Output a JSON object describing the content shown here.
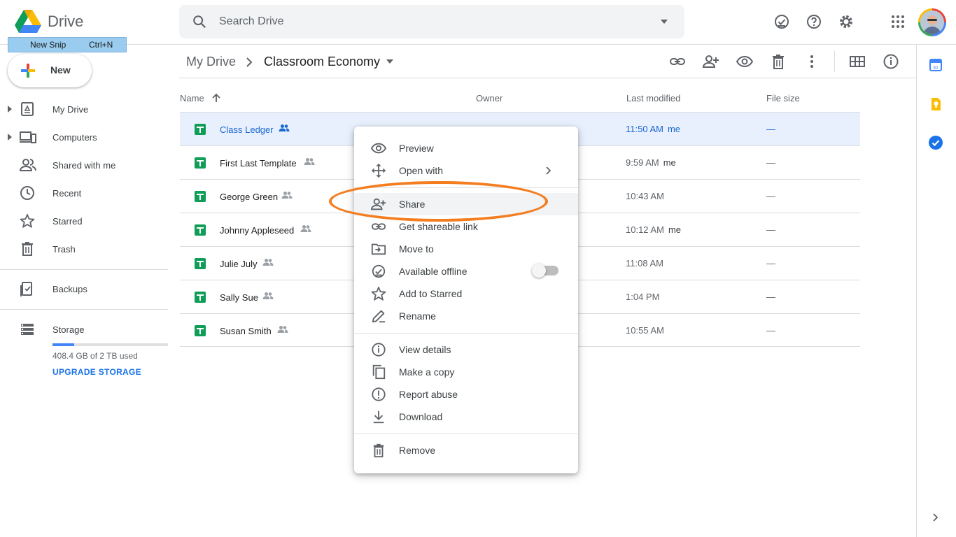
{
  "app": {
    "name": "Drive"
  },
  "snip_overlay": {
    "label": "New Snip",
    "shortcut": "Ctrl+N"
  },
  "search": {
    "placeholder": "Search Drive"
  },
  "new_button": {
    "label": "New"
  },
  "sidebar": {
    "items": [
      {
        "label": "My Drive",
        "icon": "my-drive-icon"
      },
      {
        "label": "Computers",
        "icon": "computers-icon"
      },
      {
        "label": "Shared with me",
        "icon": "shared-icon"
      },
      {
        "label": "Recent",
        "icon": "clock-icon"
      },
      {
        "label": "Starred",
        "icon": "star-icon"
      },
      {
        "label": "Trash",
        "icon": "trash-icon"
      }
    ],
    "backups": "Backups",
    "storage": {
      "label": "Storage",
      "usage_text": "408.4 GB of 2 TB used",
      "usage_fraction": 0.2,
      "upgrade": "UPGRADE STORAGE"
    }
  },
  "breadcrumb": {
    "root": "My Drive",
    "current": "Classroom Economy"
  },
  "columns": {
    "name": "Name",
    "owner": "Owner",
    "modified": "Last modified",
    "size": "File size"
  },
  "files": [
    {
      "name": "Class Ledger",
      "modified": "11:50 AM",
      "modified_by": "me",
      "size": "—",
      "selected": true
    },
    {
      "name": "First Last Template",
      "modified": "9:59 AM",
      "modified_by": "me",
      "size": "—",
      "selected": false
    },
    {
      "name": "George Green",
      "modified": "10:43 AM",
      "modified_by": "",
      "size": "—",
      "selected": false
    },
    {
      "name": "Johnny Appleseed",
      "modified": "10:12 AM",
      "modified_by": "me",
      "size": "—",
      "selected": false
    },
    {
      "name": "Julie July",
      "modified": "11:08 AM",
      "modified_by": "",
      "size": "—",
      "selected": false
    },
    {
      "name": "Sally Sue",
      "modified": "1:04 PM",
      "modified_by": "",
      "size": "—",
      "selected": false
    },
    {
      "name": "Susan Smith",
      "modified": "10:55 AM",
      "modified_by": "",
      "size": "—",
      "selected": false
    }
  ],
  "context_menu": {
    "items": [
      {
        "label": "Preview",
        "icon": "eye-icon"
      },
      {
        "label": "Open with",
        "icon": "open-with-icon"
      },
      {
        "label": "Share",
        "icon": "add-person-icon"
      },
      {
        "label": "Get shareable link",
        "icon": "link-icon"
      },
      {
        "label": "Move to",
        "icon": "move-to-icon"
      },
      {
        "label": "Available offline",
        "icon": "offline-icon",
        "toggle": false
      },
      {
        "label": "Add to Starred",
        "icon": "star-icon"
      },
      {
        "label": "Rename",
        "icon": "pencil-icon"
      },
      {
        "label": "View details",
        "icon": "info-icon"
      },
      {
        "label": "Make a copy",
        "icon": "copy-icon"
      },
      {
        "label": "Report abuse",
        "icon": "alert-icon"
      },
      {
        "label": "Download",
        "icon": "download-icon"
      },
      {
        "label": "Remove",
        "icon": "trash-icon"
      }
    ],
    "highlighted": "Share"
  },
  "colors": {
    "accent": "#1a73e8",
    "highlight_ellipse": "#f47d20",
    "sheets_green": "#0f9d58",
    "selected_row": "#e8f0fe"
  }
}
